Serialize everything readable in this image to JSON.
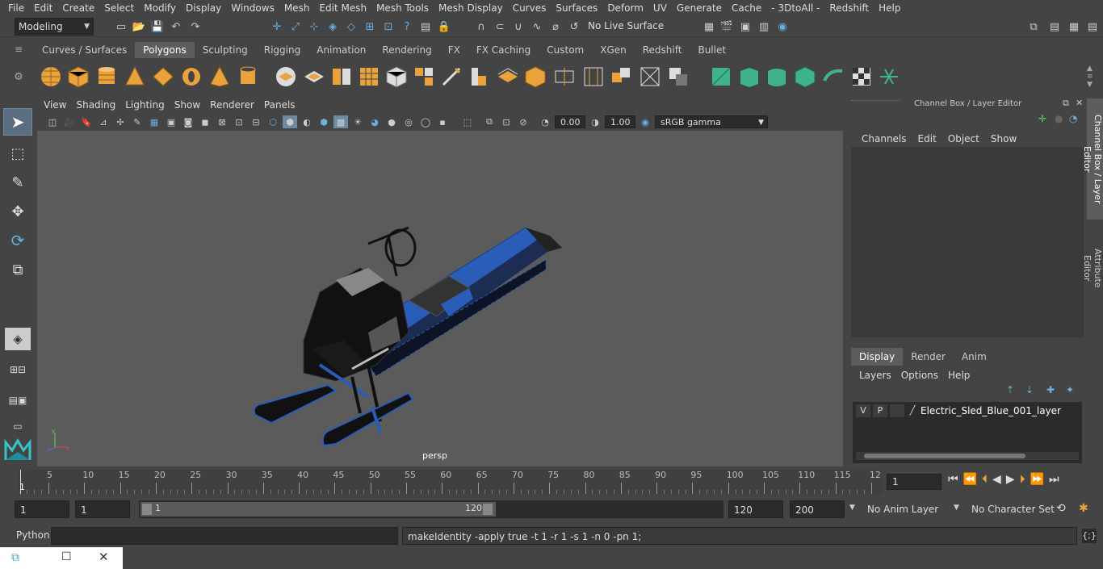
{
  "menubar": {
    "items": [
      "File",
      "Edit",
      "Create",
      "Select",
      "Modify",
      "Display",
      "Windows",
      "Mesh",
      "Edit Mesh",
      "Mesh Tools",
      "Mesh Display",
      "Curves",
      "Surfaces",
      "Deform",
      "UV",
      "Generate",
      "Cache",
      "- 3DtoAll -",
      "Redshift",
      "Help"
    ]
  },
  "statusline": {
    "mode": "Modeling",
    "live_surface": "No Live Surface"
  },
  "shelf": {
    "tabs": [
      "Curves / Surfaces",
      "Polygons",
      "Sculpting",
      "Rigging",
      "Animation",
      "Rendering",
      "FX",
      "FX Caching",
      "Custom",
      "XGen",
      "Redshift",
      "Bullet"
    ],
    "active_tab": "Polygons"
  },
  "viewport": {
    "menu": [
      "View",
      "Shading",
      "Lighting",
      "Show",
      "Renderer",
      "Panels"
    ],
    "exposure": "0.00",
    "gamma": "1.00",
    "color_space": "sRGB gamma",
    "camera_label": "persp"
  },
  "channelbox": {
    "title": "Channel Box / Layer Editor",
    "menu": [
      "Channels",
      "Edit",
      "Object",
      "Show"
    ],
    "layer_tabs": [
      "Display",
      "Render",
      "Anim"
    ],
    "active_layer_tab": "Display",
    "layer_menu": [
      "Layers",
      "Options",
      "Help"
    ],
    "layer": {
      "v": "V",
      "p": "P",
      "name": "Electric_Sled_Blue_001_layer"
    }
  },
  "side_tabs": [
    "Channel Box / Layer Editor",
    "Attribute Editor"
  ],
  "timeline": {
    "ticks": [
      "5",
      "10",
      "15",
      "20",
      "25",
      "30",
      "35",
      "40",
      "45",
      "50",
      "55",
      "60",
      "65",
      "70",
      "75",
      "80",
      "85",
      "90",
      "95",
      "100",
      "105",
      "110",
      "115",
      "12"
    ],
    "start_marker": "1",
    "current_frame": "1"
  },
  "range": {
    "start": "1",
    "playback_start": "1",
    "slider_start": "1",
    "slider_end": "120",
    "playback_end": "120",
    "end": "200",
    "anim_layer": "No Anim Layer",
    "character_set": "No Character Set"
  },
  "cmdline": {
    "language": "Python",
    "input": "",
    "output": "makeIdentity -apply true -t 1 -r 1 -s 1 -n 0 -pn 1;"
  },
  "colors": {
    "accent": "#5285a6",
    "shelf_icon": "#e8a33c",
    "sled_blue": "#2a5db8",
    "viewport_bg": "#5b5b5b"
  }
}
